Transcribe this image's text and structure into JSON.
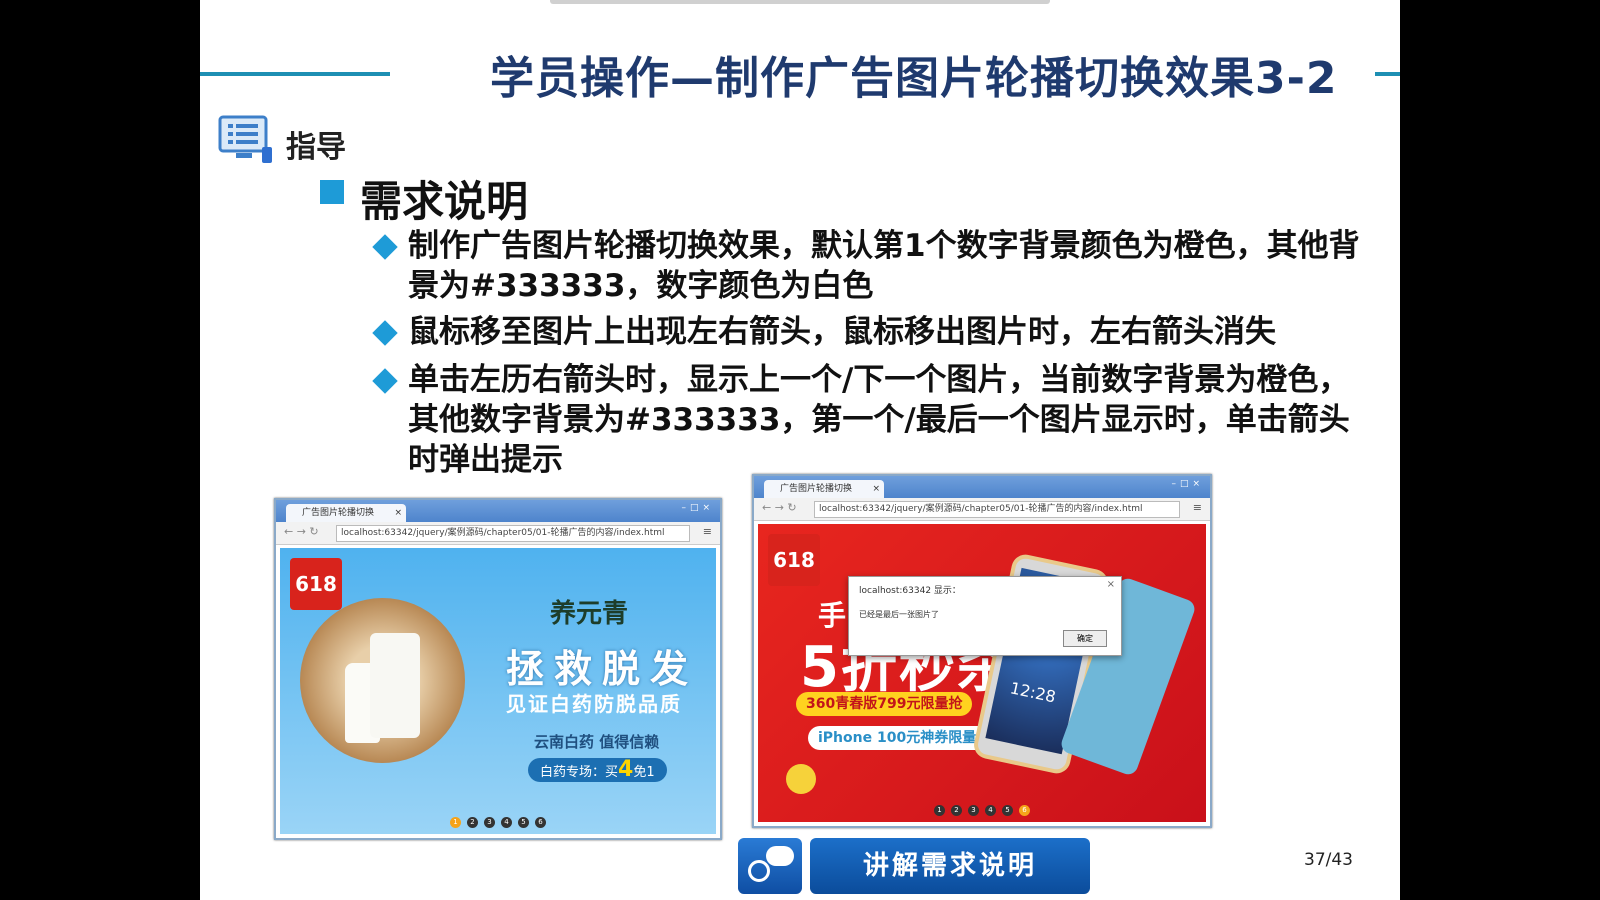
{
  "slide": {
    "title": "学员操作—制作广告图片轮播切换效果3-2",
    "guide_label": "指导",
    "section_heading": "需求说明",
    "items": [
      "制作广告图片轮播切换效果，默认第1个数字背景颜色为橙色，其他背景为#333333，数字颜色为白色",
      "鼠标移至图片上出现左右箭头，鼠标移出图片时，左右箭头消失",
      "单击左历右箭头时，显示上一个/下一个图片，当前数字背景为橙色，其他数字背景为#333333，第一个/最后一个图片显示时，单击箭头时弹出提示"
    ],
    "page_number": "37/43",
    "button_label": "讲解需求说明"
  },
  "browser_left": {
    "tab_title": "广告图片轮播切换",
    "url": "localhost:63342/jquery/案例源码/chapter05/01-轮播广告的内容/index.html",
    "ad": {
      "logo": "618",
      "brand": "养元青",
      "headline": "拯救脱发",
      "subline": "见证白药防脱品质",
      "brand_line": "云南白药 值得信赖",
      "promo_prefix": "白药专场：买",
      "promo_number": "4",
      "promo_suffix": "免1"
    },
    "dots": [
      "1",
      "2",
      "3",
      "4",
      "5",
      "6"
    ],
    "active_dot": 0
  },
  "browser_right": {
    "tab_title": "广告图片轮播切换",
    "url": "localhost:63342/jquery/案例源码/chapter05/01-轮播广告的内容/index.html",
    "dialog": {
      "title": "localhost:63342 显示：",
      "message": "已经是最后一张图片了",
      "ok_label": "确定"
    },
    "ad": {
      "logo": "618",
      "line1": "手机爆款",
      "headline": "5折秒杀",
      "pill1": "360青春版799元限量抢",
      "pill2": "iPhone 100元神券限量领",
      "phone_time": "12:28"
    },
    "dots": [
      "1",
      "2",
      "3",
      "4",
      "5",
      "6"
    ],
    "active_dot": 5
  },
  "colors": {
    "accent": "#1e9bd7",
    "title": "#1f3a6e",
    "active_dot": "#f5a31a",
    "inactive_dot": "#333333"
  }
}
